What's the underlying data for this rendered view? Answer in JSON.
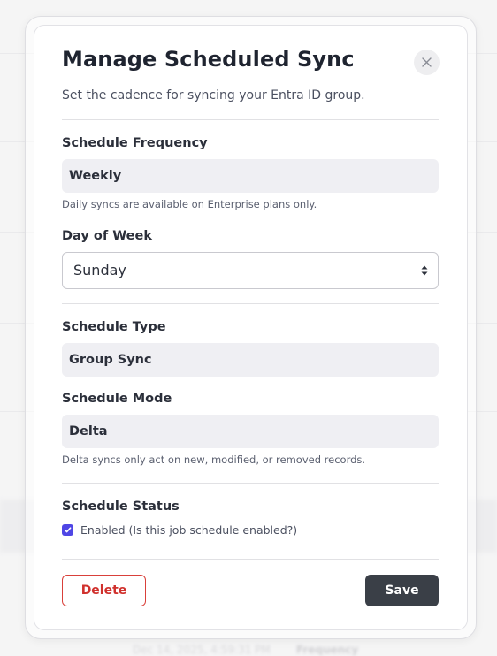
{
  "background": {
    "frequency_label": "Frequency",
    "date_text": "Dec 14, 2025, 4:59:31 PM"
  },
  "modal": {
    "title": "Manage Scheduled Sync",
    "subtitle": "Set the cadence for syncing your Entra ID group.",
    "close_icon": "close-icon",
    "frequency": {
      "label": "Schedule Frequency",
      "value": "Weekly",
      "hint": "Daily syncs are available on Enterprise plans only."
    },
    "day_of_week": {
      "label": "Day of Week",
      "selected": "Sunday"
    },
    "type": {
      "label": "Schedule Type",
      "value": "Group Sync"
    },
    "mode": {
      "label": "Schedule Mode",
      "value": "Delta",
      "hint": "Delta syncs only act on new, modified, or removed records."
    },
    "status": {
      "label": "Schedule Status",
      "checkbox_label": "Enabled (Is this job schedule enabled?)",
      "checked": true
    },
    "delete_label": "Delete",
    "save_label": "Save"
  },
  "colors": {
    "accent": "#4f46e5",
    "danger": "#d0312d",
    "primary_button": "#3a3f47"
  }
}
